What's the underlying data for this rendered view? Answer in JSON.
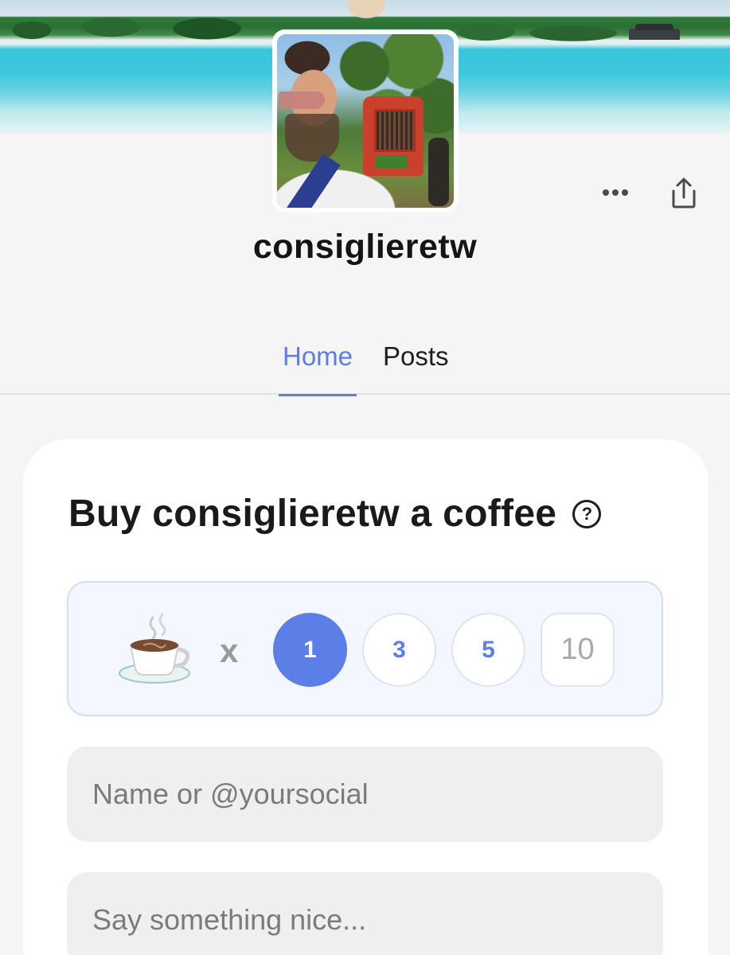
{
  "profile": {
    "username": "consiglieretw",
    "cover_image": "beach-cover",
    "avatar_image": "profile-photo"
  },
  "actions": {
    "more_icon": "more-dots-icon",
    "share_icon": "share-icon"
  },
  "tabs": [
    {
      "label": "Home",
      "active": true
    },
    {
      "label": "Posts",
      "active": false
    }
  ],
  "support_card": {
    "title": "Buy consiglieretw a coffee",
    "help_icon_glyph": "?",
    "cup_icon": "coffee-cup-icon",
    "multiplier": "x",
    "quantities": [
      "1",
      "3",
      "5",
      "10"
    ],
    "selected_quantity": "1",
    "name_field": {
      "value": "",
      "placeholder": "Name or @yoursocial"
    },
    "message_field": {
      "value": "",
      "placeholder": "Say something nice..."
    }
  },
  "colors": {
    "accent": "#5b7fe6",
    "page_background": "#f5f5f5",
    "card_background": "#ffffff",
    "picker_background": "#f4f7ff",
    "field_background": "#efefef"
  }
}
